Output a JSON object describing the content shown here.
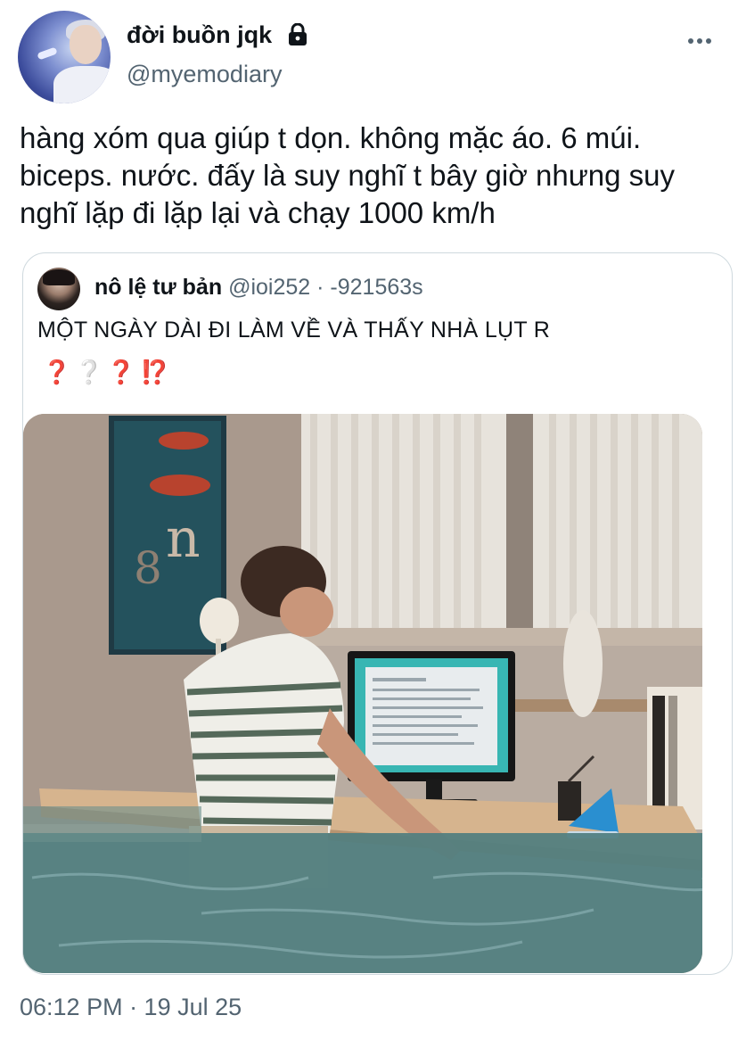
{
  "author": {
    "display_name": "đời buồn jqk",
    "handle": "@myemodiary",
    "protected": true,
    "avatar_icon": "profile-photo"
  },
  "tweet": {
    "text": "hàng xóm qua giúp t dọn. không mặc áo. 6 múi. biceps. nước. đấy là suy nghĩ t bây giờ nhưng suy nghĩ lặp đi lặp lại và chạy 1000 km/h",
    "timestamp": "06:12 PM · 19 Jul 25"
  },
  "quoted_tweet": {
    "display_name": "nô lệ tư bản",
    "handle": "@ioi252",
    "separator": "·",
    "time": "-921563s",
    "text": "MỘT NGÀY DÀI ĐI LÀM VỀ VÀ THẤY NHÀ LỤT R",
    "emojis": [
      "❓",
      "❔",
      "❓",
      "⁉️"
    ],
    "media_description_icon": "flooded-office-photo"
  },
  "menu": {
    "more_icon": "more-horizontal-icon"
  },
  "colors": {
    "text_primary": "#0f1419",
    "text_secondary": "#536471",
    "border": "#cfd9de"
  }
}
